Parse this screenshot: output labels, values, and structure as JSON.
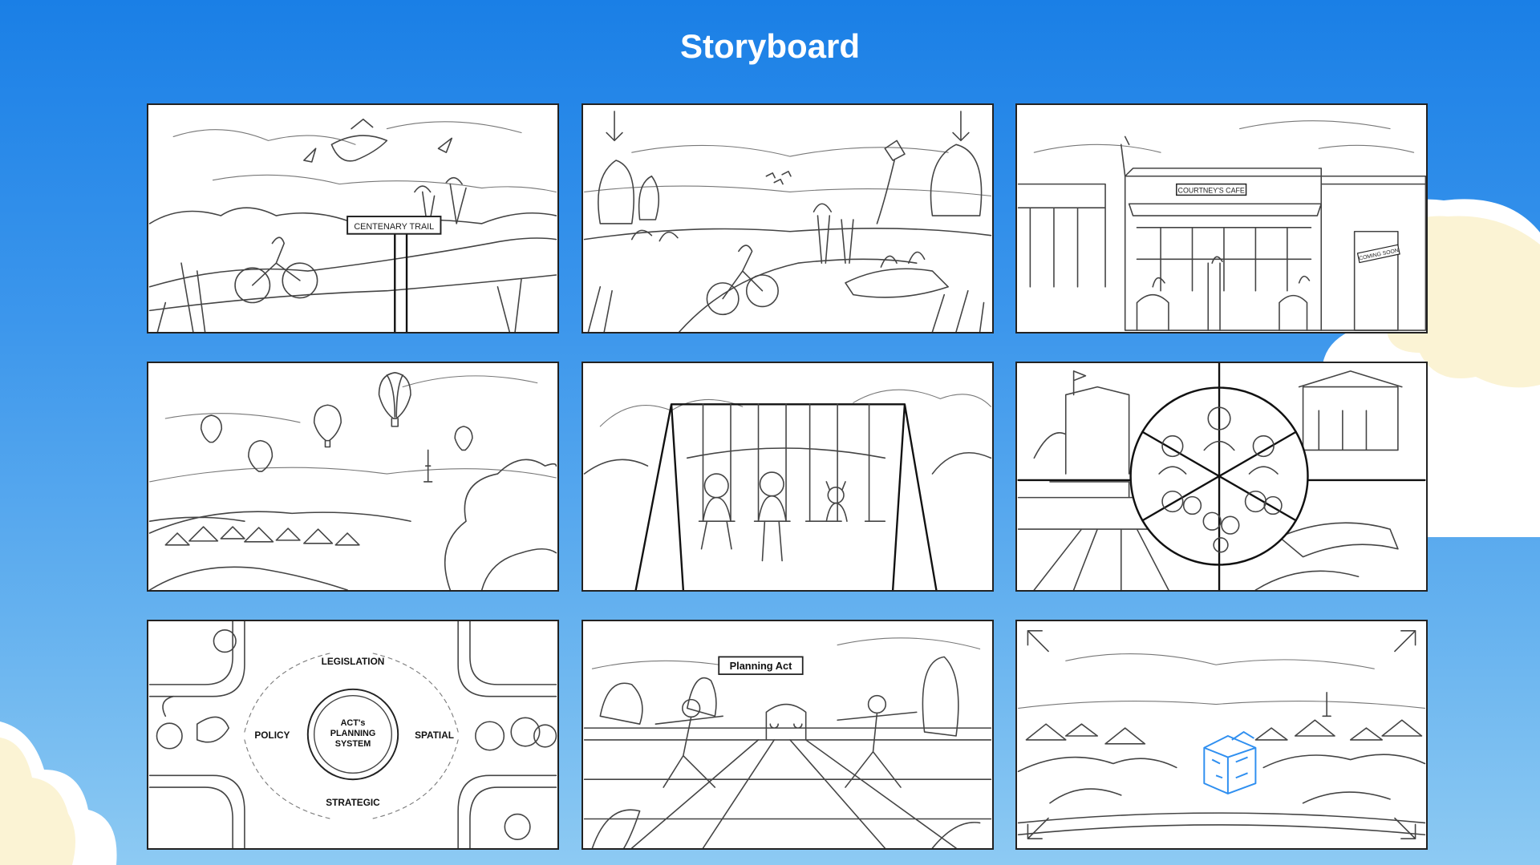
{
  "page": {
    "title": "Storyboard"
  },
  "panels": [
    {
      "id": 1,
      "sign": "CENTENARY TRAIL"
    },
    {
      "id": 2
    },
    {
      "id": 3,
      "cafe_sign": "COURTNEY'S CAFE",
      "door_sign": "COMING SOON"
    },
    {
      "id": 4
    },
    {
      "id": 5
    },
    {
      "id": 6
    },
    {
      "id": 7,
      "center_line1": "ACT's",
      "center_line2": "PLANNING",
      "center_line3": "SYSTEM",
      "top": "LEGISLATION",
      "left": "POLICY",
      "right": "SPATIAL",
      "bottom": "STRATEGIC"
    },
    {
      "id": 8,
      "sign": "Planning Act"
    },
    {
      "id": 9
    }
  ],
  "colors": {
    "bg_top": "#1a7fe6",
    "bg_bottom": "#8dcaf3",
    "cloud": "#fbf3d4",
    "sketch": "#444444",
    "highlight": "#2f8ff0"
  }
}
